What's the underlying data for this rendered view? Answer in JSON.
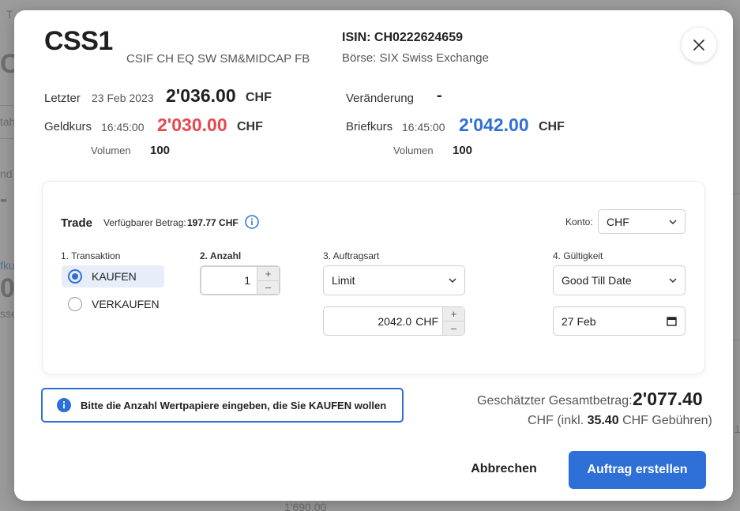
{
  "background": {
    "fragments": [
      "T",
      "C",
      "tah",
      "nd",
      "-",
      "fku",
      "0",
      "sse",
      "1'690.00",
      "1"
    ]
  },
  "header": {
    "ticker": "CSS1",
    "fullname": "CSIF CH EQ SW SM&MIDCAP FB",
    "isin": "ISIN: CH0222624659",
    "exchange": "Börse: SIX Swiss Exchange"
  },
  "quote": {
    "last_label": "Letzter",
    "last_date": "23 Feb 2023",
    "last_price": "2'036.00",
    "currency": "CHF",
    "change_label": "Veränderung",
    "change_value": "-",
    "bid_label": "Geldkurs",
    "bid_time": "16:45:00",
    "bid_price": "2'030.00",
    "ask_label": "Briefkurs",
    "ask_time": "16:45:00",
    "ask_price": "2'042.00",
    "volume_label": "Volumen",
    "bid_volume": "100",
    "ask_volume": "100"
  },
  "trade": {
    "title": "Trade",
    "available_label": "Verfügbarer Betrag:",
    "available_amount": "197.77 CHF",
    "account_label": "Konto:",
    "account_value": "CHF",
    "transaction_label": "1. Transaktion",
    "buy_label": "KAUFEN",
    "sell_label": "VERKAUFEN",
    "selected_transaction": "KAUFEN",
    "quantity_label": "2. Anzahl",
    "quantity_value": "1",
    "order_type_label": "3. Auftragsart",
    "order_type_value": "Limit",
    "limit_price": "2042.0",
    "limit_currency": "CHF",
    "validity_label": "4. Gültigkeit",
    "validity_value": "Good Till Date",
    "validity_date": "27 Feb"
  },
  "info": {
    "message": "Bitte die Anzahl Wertpapiere eingeben, die Sie KAUFEN wollen"
  },
  "summary": {
    "total_label": "Geschätzter Gesamtbetrag:",
    "total_value": "2'077.40",
    "fee_prefix": "CHF (inkl.",
    "fee_value": "35.40",
    "fee_suffix": "CHF Gebühren)"
  },
  "actions": {
    "cancel_label": "Abbrechen",
    "submit_label": "Auftrag erstellen"
  },
  "colors": {
    "accent": "#2f6fd8",
    "bid": "#e5484d",
    "ask": "#2f6fd8"
  }
}
